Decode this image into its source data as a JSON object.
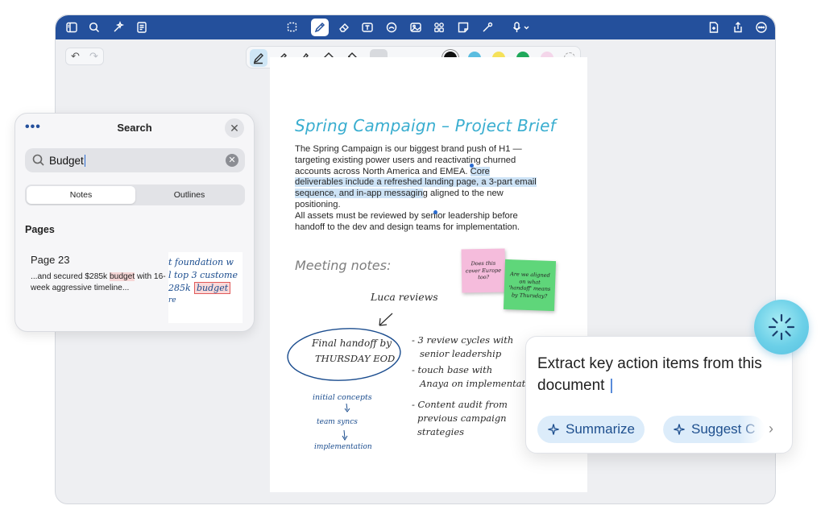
{
  "app": {
    "top_icons_left": [
      "sidebar-icon",
      "search-icon",
      "ai-sparkle-icon",
      "document-list-icon"
    ],
    "top_icons_center": [
      "lasso-select-icon",
      "pen-tool-icon",
      "eraser-icon",
      "text-box-icon",
      "shapes-icon",
      "image-icon",
      "elements-icon",
      "sticky-note-icon",
      "laser-pointer-icon",
      "microphone-icon"
    ],
    "top_icons_right": [
      "add-page-icon",
      "share-icon",
      "more-icon"
    ]
  },
  "pen_toolbar": {
    "tools": [
      "fountain-pen-icon",
      "ball-pen-icon",
      "brush-pen-icon",
      "shape-icon",
      "highlighter-icon"
    ],
    "colors": [
      "#111111",
      "#5bbde0",
      "#f5e15a",
      "#1fa85a",
      "#f4d6ea"
    ]
  },
  "search": {
    "title": "Search",
    "query": "Budget",
    "tabs": [
      "Notes",
      "Outlines"
    ],
    "active_tab": "Notes",
    "section": "Pages",
    "result": {
      "page": "Page 23",
      "snippet_before": "...and secured $285k ",
      "snippet_match": "budget",
      "snippet_after": " with 16-week aggressive timeline...",
      "thumb_lines": [
        "t foundation w",
        "l top 3 custome",
        "285k",
        "budget",
        "re"
      ]
    }
  },
  "document": {
    "title": "Spring Campaign – Project Brief",
    "para_a": "The Spring Campaign is our biggest brand push of H1 — targeting existing power users and reactivating churned accounts across North America and EMEA. ",
    "para_highlight": "Core deliverables include a refreshed landing page, a 3-part email sequence, and in-app messagin",
    "para_b": "g aligned to the new positioning.",
    "para_c": "All assets must be reviewed by senior leadership before handoff to the dev and design teams for implementation.",
    "meeting_heading": "Meeting notes:",
    "sticky_pink": "Does this cover Europe too?",
    "sticky_green": "Are we aligned on what 'handoff' means by Thursday?",
    "luca": "Luca reviews",
    "circle_line1": "Final handoff by",
    "circle_line2": "THURSDAY EOD",
    "bullet1_a": "- 3 review cycles with",
    "bullet1_b": "senior leadership",
    "bullet2_a": "- touch base with",
    "bullet2_b": "Anaya on implementat",
    "bullet3_a": "- Content audit from",
    "bullet3_b": "previous campaign",
    "bullet3_c": "strategies",
    "flow1": "initial concepts",
    "flow2": "team syncs",
    "flow3": "implementation"
  },
  "ai": {
    "prompt": "Extract key action items from this document",
    "chips": [
      "Summarize",
      "Suggest C"
    ]
  }
}
